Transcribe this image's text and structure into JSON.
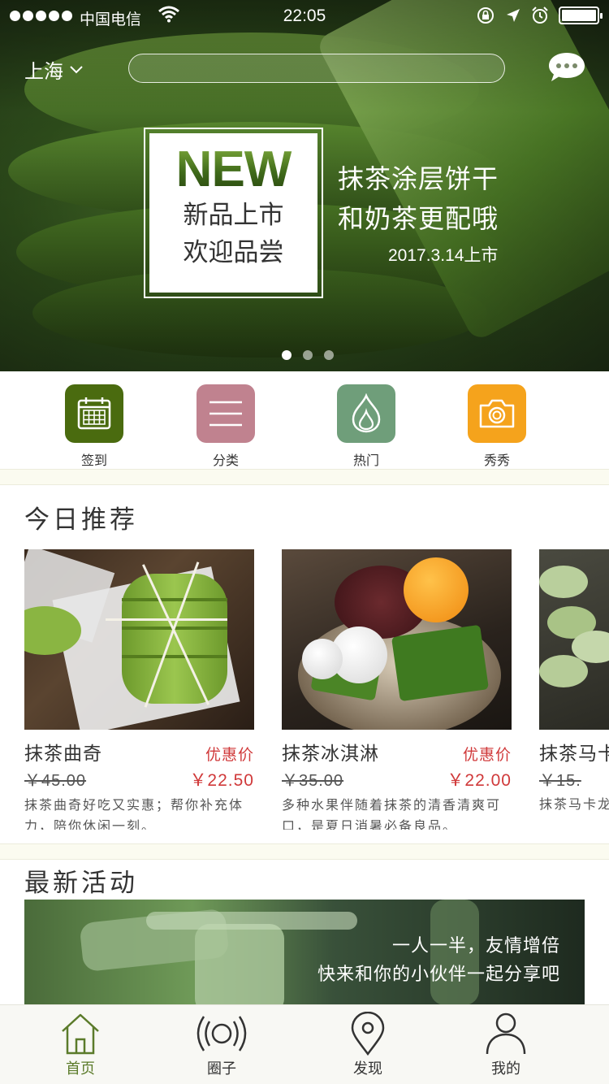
{
  "status_bar": {
    "carrier": "中国电信",
    "time": "22:05"
  },
  "header": {
    "city": "上海",
    "search_placeholder": ""
  },
  "banner": {
    "badge_new": "NEW",
    "badge_line1": "新品上市",
    "badge_line2": "欢迎品尝",
    "caption_line1": "抹茶涂层饼干",
    "caption_line2": "和奶茶更配哦",
    "date": "2017.3.14上市",
    "dots": {
      "count": 3,
      "active": 1
    }
  },
  "quick_entries": [
    {
      "label": "签到",
      "icon": "calendar-icon",
      "color": "#4a6b0f"
    },
    {
      "label": "分类",
      "icon": "menu-icon",
      "color": "#c0828f"
    },
    {
      "label": "热门",
      "icon": "flame-icon",
      "color": "#6f9e7a"
    },
    {
      "label": "秀秀",
      "icon": "camera-icon",
      "color": "#f5a31c"
    }
  ],
  "today": {
    "title": "今日推荐",
    "items": [
      {
        "name": "抹茶曲奇",
        "promo_label": "优惠价",
        "old_price": "￥45.00",
        "price": "￥22.50",
        "desc": "抹茶曲奇好吃又实惠；帮你补充体力，陪你休闲一刻。"
      },
      {
        "name": "抹茶冰淇淋",
        "promo_label": "优惠价",
        "old_price": "￥35.00",
        "price": "￥22.00",
        "desc": "多种水果伴随着抹茶的清香清爽可口，是夏日消暑必备良品。"
      },
      {
        "name": "抹茶马卡龙",
        "promo_label": "",
        "old_price": "￥15.",
        "price": "",
        "desc": "抹茶马卡龙，甜蜜丝"
      }
    ]
  },
  "activities": {
    "title": "最新活动",
    "banner_line1": "一人一半，友情增倍",
    "banner_line2": "快来和你的小伙伴一起分享吧"
  },
  "tabbar": [
    {
      "label": "首页",
      "icon": "home-icon",
      "active": true
    },
    {
      "label": "圈子",
      "icon": "broadcast-icon",
      "active": false
    },
    {
      "label": "发现",
      "icon": "location-pin-icon",
      "active": false
    },
    {
      "label": "我的",
      "icon": "user-icon",
      "active": false
    }
  ],
  "colors": {
    "accent_green": "#5b7b2a",
    "price_red": "#d0393a",
    "separator_bg": "#fbfbf0"
  }
}
